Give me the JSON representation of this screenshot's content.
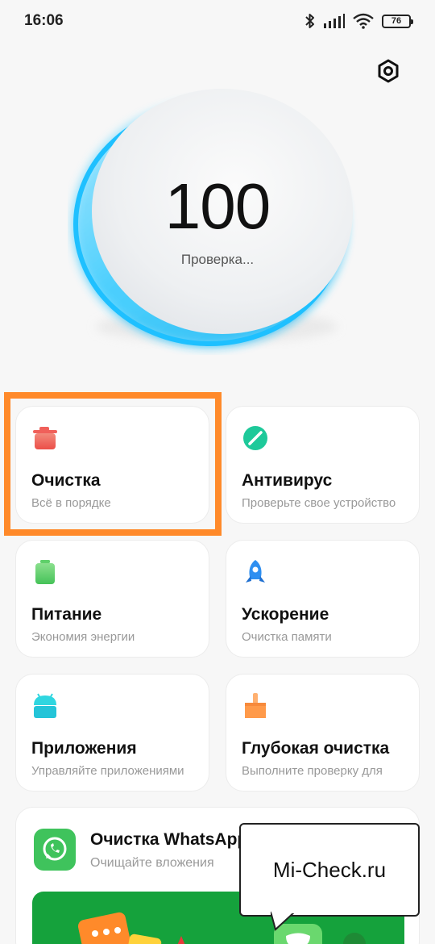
{
  "status_bar": {
    "time": "16:06",
    "battery": "76",
    "icons": [
      "bluetooth-icon",
      "signal-icon",
      "wifi-icon",
      "battery-icon"
    ]
  },
  "header": {
    "settings_icon": "gear-icon"
  },
  "score": {
    "value": "100",
    "status": "Проверка..."
  },
  "cards": [
    {
      "id": "cleanup",
      "title": "Очистка",
      "subtitle": "Всё в порядке",
      "icon": "trash-icon",
      "color": "#f0605a"
    },
    {
      "id": "antivirus",
      "title": "Антивирус",
      "subtitle": "Проверьте свое устройство",
      "icon": "shield-check-icon",
      "color": "#1ec99a"
    },
    {
      "id": "power",
      "title": "Питание",
      "subtitle": "Экономия энергии",
      "icon": "battery-icon",
      "color": "#5fd06a"
    },
    {
      "id": "boost",
      "title": "Ускорение",
      "subtitle": "Очистка памяти",
      "icon": "rocket-icon",
      "color": "#2f8ff0"
    },
    {
      "id": "apps",
      "title": "Приложения",
      "subtitle": "Управляйте приложениями",
      "icon": "android-icon",
      "color": "#2fd6e0"
    },
    {
      "id": "deep_clean",
      "title": "Глубокая очистка",
      "subtitle": "Выполните проверку для",
      "icon": "brush-icon",
      "color": "#ff9a4a"
    }
  ],
  "whatsapp": {
    "title": "Очистка WhatsApp",
    "subtitle": "Очищайте вложения",
    "icon": "whatsapp-icon",
    "color": "#3fc35c"
  },
  "annotation": {
    "text": "Mi-Check.ru",
    "highlight_color": "#ff8a2a"
  }
}
